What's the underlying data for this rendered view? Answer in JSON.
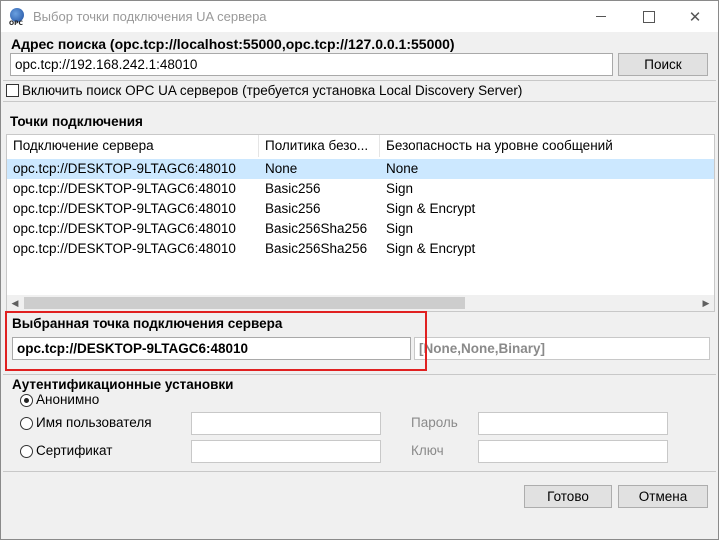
{
  "window": {
    "title": "Выбор точки подключения UA сервера",
    "icon_label": "OPC"
  },
  "search": {
    "label": "Адрес поиска (opc.tcp://localhost:55000,opc.tcp://127.0.0.1:55000)",
    "value": "opc.tcp://192.168.242.1:48010",
    "button": "Поиск"
  },
  "discovery": {
    "checkbox_label": "Включить поиск OPC UA серверов (требуется установка Local Discovery Server)",
    "checked": false
  },
  "endpoints": {
    "group_label": "Точки подключения",
    "columns": [
      "Подключение сервера",
      "Политика безо...",
      "Безопасность на уровне сообщений"
    ],
    "rows": [
      [
        "opc.tcp://DESKTOP-9LTAGC6:48010",
        "None",
        "None"
      ],
      [
        "opc.tcp://DESKTOP-9LTAGC6:48010",
        "Basic256",
        "Sign"
      ],
      [
        "opc.tcp://DESKTOP-9LTAGC6:48010",
        "Basic256",
        "Sign & Encrypt"
      ],
      [
        "opc.tcp://DESKTOP-9LTAGC6:48010",
        "Basic256Sha256",
        "Sign"
      ],
      [
        "opc.tcp://DESKTOP-9LTAGC6:48010",
        "Basic256Sha256",
        "Sign & Encrypt"
      ]
    ],
    "selected_row": 0
  },
  "selected_endpoint": {
    "label": "Выбранная точка подключения сервера",
    "value": "opc.tcp://DESKTOP-9LTAGC6:48010",
    "security_summary": "[None,None,Binary]"
  },
  "auth": {
    "label": "Аутентификационные установки",
    "anonymous": "Анонимно",
    "username": "Имя пользователя",
    "certificate": "Сертификат",
    "password": "Пароль",
    "key": "Ключ",
    "selected": "anonymous"
  },
  "buttons": {
    "ok": "Готово",
    "cancel": "Отмена"
  },
  "colors": {
    "selection": "#cce8ff",
    "highlight": "#e02020"
  }
}
